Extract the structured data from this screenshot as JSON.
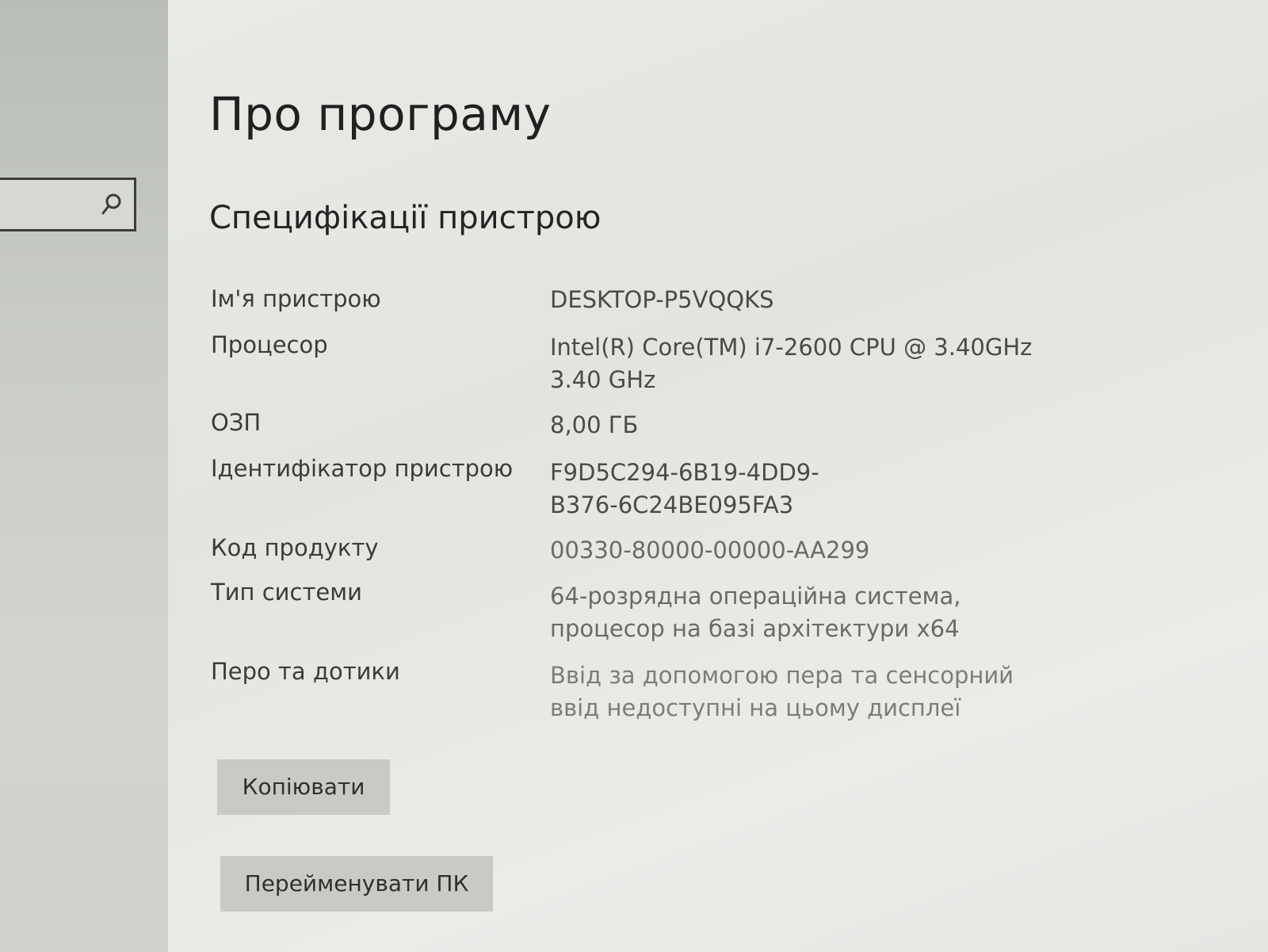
{
  "search": {
    "icon": "search-icon"
  },
  "page": {
    "title": "Про програму",
    "section_title": "Специфікації пристрою"
  },
  "specs": [
    {
      "label": "Ім'я пристрою",
      "value_lines": [
        "DESKTOP-P5VQQKS"
      ]
    },
    {
      "label": "Процесор",
      "value_lines": [
        "Intel(R) Core(TM) i7-2600 CPU @ 3.40GHz",
        "3.40 GHz"
      ]
    },
    {
      "label": "ОЗП",
      "value_lines": [
        "8,00 ГБ"
      ]
    },
    {
      "label": "Ідентифікатор пристрою",
      "value_lines": [
        "F9D5C294-6B19-4DD9-",
        "B376-6C24BE095FA3"
      ]
    },
    {
      "label": "Код продукту",
      "value_lines": [
        "00330-80000-00000-AA299"
      ]
    },
    {
      "label": "Тип системи",
      "value_lines": [
        "64-розрядна операційна система,",
        "процесор на базі архітектури x64"
      ]
    },
    {
      "label": "Перо та дотики",
      "value_lines": [
        "Ввід за допомогою пера та сенсорний",
        "ввід недоступні на цьому дисплеї"
      ]
    }
  ],
  "buttons": {
    "copy_label": "Копіювати",
    "rename_label": "Перейменувати ПК"
  }
}
